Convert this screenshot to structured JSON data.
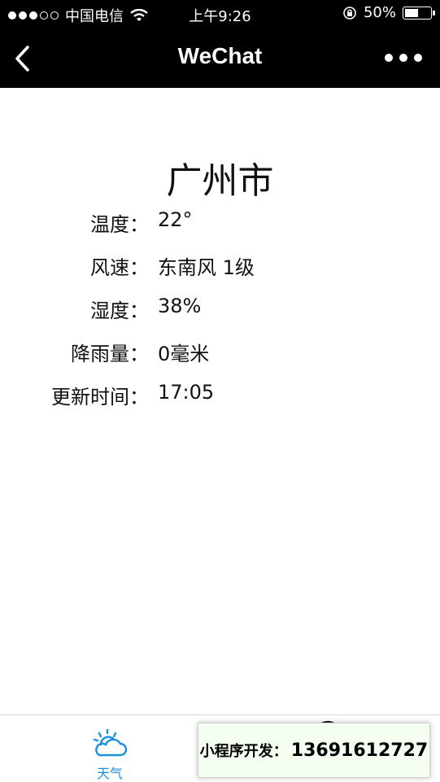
{
  "status_bar": {
    "carrier": "中国电信",
    "time": "上午9:26",
    "battery_text": "50%",
    "battery_level": 0.5,
    "signal_bars_filled": 3,
    "signal_bars_total": 5
  },
  "nav": {
    "title": "WeChat",
    "back_icon": "chevron-left-icon",
    "more_icon": "more-dots-icon"
  },
  "weather": {
    "city": "广州市",
    "fields": [
      {
        "label": "温度：",
        "value": "22°"
      },
      {
        "label": "风速：",
        "value": "东南风 1级"
      },
      {
        "label": "湿度：",
        "value": "38%"
      },
      {
        "label": "降雨量：",
        "value": "0毫米"
      },
      {
        "label": "更新时间：",
        "value": "17:05"
      }
    ]
  },
  "tabbar": {
    "tabs": [
      {
        "label": "天气",
        "icon": "cloud-sun-icon",
        "active": true
      },
      {
        "label": "",
        "icon": "circle-icon",
        "active": false
      }
    ],
    "active_color": "#1b8fe0"
  },
  "overlay_banner": {
    "prefix": "小程序开发：",
    "phone": "13691612727"
  }
}
